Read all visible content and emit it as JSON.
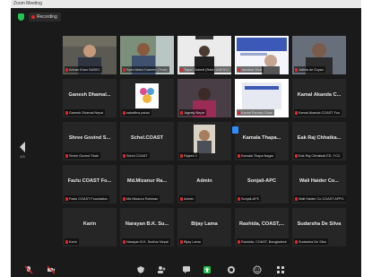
{
  "window": {
    "title": "Zoom Meeting"
  },
  "top": {
    "recording_label": "Recording"
  },
  "sidebar": {
    "page_label": "1/3"
  },
  "participants": [
    {
      "kind": "video",
      "tag": "Adnan Khan SASEC"
    },
    {
      "kind": "video",
      "tag": "Syed Abdul Kareem (Trust)"
    },
    {
      "kind": "video",
      "tag": "Tapan Subedi (Rattu UNESCO)"
    },
    {
      "kind": "video",
      "tag": "Jawahar Dhal"
    },
    {
      "kind": "video",
      "tag": "Jothila de Zoysa"
    },
    {
      "kind": "name",
      "center": "Ganesh  Dhamal...",
      "tag": "Ganesh Dhamal Nepal"
    },
    {
      "kind": "logo",
      "tag": "sahaittva pahal"
    },
    {
      "kind": "video",
      "tag": "Jagraty Nepal"
    },
    {
      "kind": "video",
      "tag": "Kamal Pandey Ghari"
    },
    {
      "kind": "name",
      "center": "Kamal Akanda C...",
      "tag": "Kamal Akanda COAST Fou"
    },
    {
      "kind": "name",
      "center": "Shree Govind S...",
      "tag": "Shree Govind Shah"
    },
    {
      "kind": "name",
      "center": "Schel.COAST",
      "tag": "Schel.COAST"
    },
    {
      "kind": "video",
      "tag": "Rajesh 1"
    },
    {
      "kind": "name",
      "center": "Kamala  Thapa...",
      "tag": "Kamala Thapa Nagar"
    },
    {
      "kind": "name",
      "center": "Eak Raj Chhatka...",
      "tag": "Eak Raj Chhatkali ED, YCC"
    },
    {
      "kind": "name",
      "center": "Fazlu COAST Fo...",
      "tag": "Fazlu COAST Foundation"
    },
    {
      "kind": "name",
      "center": "Md.Mizanur  Ra...",
      "tag": "Md.Mizanur Rahman"
    },
    {
      "kind": "name",
      "center": "Admin",
      "tag": "Admin"
    },
    {
      "kind": "name",
      "center": "Sonjail-APC",
      "tag": "Sonjail-APC"
    },
    {
      "kind": "name",
      "center": "Wali  Haider  Co...",
      "tag": "Wali Haider Co COAST APPCC"
    },
    {
      "kind": "name",
      "center": "Karin",
      "tag": "Karin"
    },
    {
      "kind": "name",
      "center": "Narayan B.K. Su...",
      "tag": "Narayan B.K. Sudhar Nepal"
    },
    {
      "kind": "name",
      "center": "Bijay  Lama",
      "tag": "Bijay Lama"
    },
    {
      "kind": "name",
      "center": "Rashida,  COAST,...",
      "tag": "Rashida, COAST, Bangladesh"
    },
    {
      "kind": "name",
      "center": "Sudarsha De Silva",
      "tag": "Sudarsha De Silva"
    }
  ],
  "colors": {
    "tile_bg": "#262626",
    "window_bg": "#1a1a1a",
    "mic_muted": "#e02828",
    "active_speaker": "#c9c23c",
    "accent_blue": "#2d8cff",
    "shield_green": "#23c552"
  },
  "toolbar": {
    "icons": [
      "mic-icon",
      "video-icon",
      "security-icon",
      "participants-icon",
      "chat-icon",
      "share-screen-icon",
      "record-icon",
      "reactions-icon",
      "apps-icon"
    ]
  }
}
